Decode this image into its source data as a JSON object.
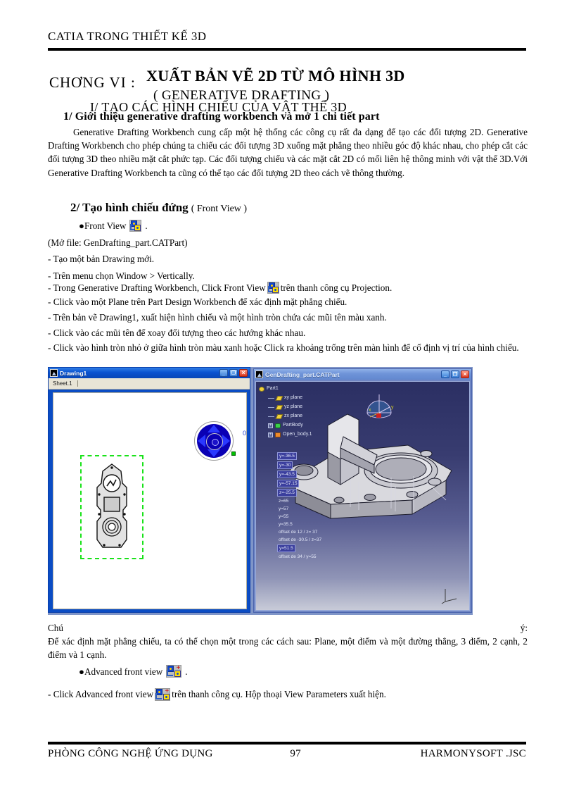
{
  "header": {
    "title": "CATIA TRONG THIẾT KẾ 3D"
  },
  "chapter": {
    "label": "CHƠNG   VI :",
    "main_title": "XUẤT BẢN VẼ 2D TỪ MÔ HÌNH 3D",
    "subtitle": "( GENERATIVE DRAFTING )",
    "section_roman": "I/ TẠO CÁC HÌNH CHIẾU CỦA VẬT THỂ 3D",
    "section_one": "1/ Giới thiệu generative drafting workbench và mở 1 chi tiết part"
  },
  "body": {
    "intro_paragraph": "Generative  Drafting  Workbench  cung cấp một hệ thống  các công cụ rất đa dạng để tạo các đối tượng 2D. Generative  Drafting  Workbench   cho phép chúng ta chiếu  các đối tượng 3D xuống  mặt phẳng theo nhiều  góc độ khác nhau, cho phép cắt các đối tượng 3D theo nhiều  mặt cắt phức tạp. Các đối tượng chiếu và các mặt cắt 2D có mối liên hệ thông  minh  với vật thể 3D.Với  Generative  Drafting  Workbench ta cũng có thể tạo các đối tượng 2D theo cách vẽ thông  thường.",
    "heading2_bold": "2/ Tạo hình chiếu đứng",
    "heading2_plain": "( Front View )",
    "bullet_front_view": "●Front View",
    "open_file_line": "(Mở file:  GenDrafting_part.CATPart)",
    "step_new_drawing": "- Tạo một bản Drawing  mới.",
    "step_menu_window": "- Trên menu chọn Window > Vertically.",
    "step_click_front_view_a": "- Trong Generative  Drafting  Workbench,  Click Front View",
    "step_click_front_view_b": "trên thanh công cụ Projection.",
    "step_click_plane": "- Click vào một Plane trên Part Design  Workbench để xác định  mặt phẳng chiếu.",
    "step_drawing1": "- Trên bản vẽ Drawing1,  xuất hiện  hình  chiếu  và một hình  tròn chứa các mũi  tên màu xanh.",
    "step_arrows": "- Click vào các mũi  tên để xoay đối tượng theo các hướng khác nhau.",
    "step_fix_position": "- Click vào hình  tròn nhỏ ở giữa hình  tròn màu xanh hoặc Click ra khoảng trống trên màn hình  để cố định vị trí của hình  chiếu.",
    "note_label_left": "Chú",
    "note_label_right": "ý:",
    "note_text": "Để xác định  mặt phẳng chiếu,  ta có thể chọn một trong các cách sau: Plane, một điểm  và một đường thẳng,  3 điểm,  2 cạnh, 2 điểm và 1 cạnh.",
    "bullet_advanced_front_view": "●Advanced front view",
    "step_advanced_a": "- Click Advanced front view",
    "step_advanced_b": "trên thanh công cụ. Hộp thoại View Parameters xuất hiện."
  },
  "screenshot": {
    "left_window": {
      "title": "Drawing1",
      "sheet_tab": "Sheet.1",
      "compass_zero_label": "0",
      "minimize_glyph": "_",
      "maximize_glyph": "❐",
      "close_glyph": "✕"
    },
    "right_window": {
      "title": "GenDrafting_part.CATPart",
      "minimize_glyph": "_",
      "maximize_glyph": "❐",
      "close_glyph": "✕",
      "tree": [
        {
          "label": "Part1",
          "icon": "part-icon",
          "level": 0
        },
        {
          "label": "xy plane",
          "icon": "plane-icon",
          "level": 1
        },
        {
          "label": "yz plane",
          "icon": "plane-icon",
          "level": 1
        },
        {
          "label": "zx plane",
          "icon": "plane-icon",
          "level": 1
        },
        {
          "label": "PartBody",
          "icon": "body-icon",
          "level": 1
        },
        {
          "label": "Open_body.1",
          "icon": "open-body-icon",
          "level": 1
        }
      ],
      "measure_labels": [
        {
          "text": "y=-36.5",
          "selected": true
        },
        {
          "text": "y=-30",
          "selected": true
        },
        {
          "text": "y=-43.5",
          "selected": true
        },
        {
          "text": "y=-57.15",
          "selected": true
        },
        {
          "text": "z=-25.5",
          "selected": true
        },
        {
          "text": "z=65",
          "selected": false
        },
        {
          "text": "y=57",
          "selected": false
        },
        {
          "text": "y=55",
          "selected": false
        },
        {
          "text": "y=35.5",
          "selected": false
        },
        {
          "text": "offset de 12 / z= 37",
          "selected": false
        },
        {
          "text": "offset de -30.5 / z=37",
          "selected": false
        },
        {
          "text": "y=51.5",
          "selected": true
        },
        {
          "text": "offset de 34 / y=55",
          "selected": false
        }
      ],
      "axis_labels": {
        "x": "x",
        "y": "y",
        "z": "z"
      }
    }
  },
  "footer": {
    "left": "PHÒNG CÔNG NGHỆ ỨNG DỤNG",
    "page_number": "97",
    "right": "HARMONYSOFT .JSC"
  },
  "colors": {
    "title_bar_active": "#0a52d0",
    "title_bar_inactive": "#6e93d8",
    "viewport_3d": "#383c70",
    "view_frame_green": "#19e219",
    "compass_blue": "#0a00b4"
  }
}
